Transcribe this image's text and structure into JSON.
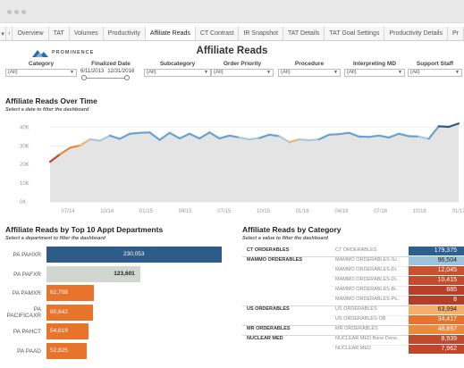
{
  "tabs": {
    "nav_down": "▾",
    "nav_prev": "‹",
    "items": [
      "Overview",
      "TAT",
      "Volumes",
      "Productivity",
      "Affiliate Reads",
      "CT Contrast",
      "IR Snapshot",
      "TAT Details",
      "TAT Goal Settings",
      "Productivity Details",
      "Pr"
    ],
    "active": "Affiliate Reads"
  },
  "header": {
    "logo_text": "PROMINENCE",
    "title": "Affiliate Reads"
  },
  "filters": {
    "category": {
      "label": "Category",
      "value": "(All)"
    },
    "finalized_date": {
      "label": "Finalized Date",
      "start": "6/11/2013",
      "end": "12/31/2016"
    },
    "subcategory": {
      "label": "Subcategory",
      "value": "(All)"
    },
    "order_priority": {
      "label": "Order Priority",
      "value": "(All)"
    },
    "procedure": {
      "label": "Procedure",
      "value": "(All)"
    },
    "interpreting_md": {
      "label": "Interpreting MD",
      "value": "(All)"
    },
    "support_staff": {
      "label": "Support Staff",
      "value": "(All)"
    }
  },
  "line_section": {
    "title": "Affiliate Reads Over Time",
    "subtitle": "Select a date to filter the dashboard"
  },
  "dept_section": {
    "title": "Affiliate Reads by Top 10 Appt Departments",
    "subtitle": "Select a department to filter the dashboard"
  },
  "cat_section": {
    "title": "Affiliate Reads by Category",
    "subtitle": "Select a value to filter the dashboard"
  },
  "colors": {
    "bar_top": "#2e5c8a",
    "bar_second": "#d1d7d0",
    "bar_orange": "#e8742c",
    "line": "#6aa2cf",
    "area": "#e4e4e4"
  },
  "chart_data": [
    {
      "type": "area",
      "title": "Affiliate Reads Over Time",
      "xlabel": "",
      "ylabel": "",
      "x": [
        "2013-07",
        "2013-08",
        "2013-09",
        "2013-10",
        "2013-11",
        "2013-12",
        "2014-01",
        "2014-02",
        "2014-03",
        "2014-04",
        "2014-05",
        "2014-06",
        "2014-07",
        "2014-08",
        "2014-09",
        "2014-10",
        "2014-11",
        "2014-12",
        "2015-01",
        "2015-02",
        "2015-03",
        "2015-04",
        "2015-05",
        "2015-06",
        "2015-07",
        "2015-08",
        "2015-09",
        "2015-10",
        "2015-11",
        "2015-12",
        "2016-01",
        "2016-02",
        "2016-03",
        "2016-04",
        "2016-05",
        "2016-06",
        "2016-07",
        "2016-08",
        "2016-09",
        "2016-10",
        "2016-11",
        "2016-12"
      ],
      "values": [
        21500,
        25500,
        29000,
        30200,
        33500,
        32800,
        35500,
        33800,
        36500,
        37000,
        37200,
        33200,
        37000,
        34000,
        36500,
        34000,
        37200,
        34000,
        35500,
        34500,
        33500,
        34200,
        36000,
        35200,
        32000,
        33500,
        33000,
        33500,
        36000,
        36300,
        37000,
        35000,
        34800,
        35500,
        34500,
        36500,
        35200,
        35000,
        33800,
        40500,
        40200,
        42000
      ],
      "xticks": [
        "07/14",
        "10/14",
        "01/15",
        "04/15",
        "07/15",
        "10/15",
        "01/16",
        "04/16",
        "07/16",
        "10/16",
        "01/17"
      ],
      "yticks": [
        "40K",
        "30K",
        "20K",
        "10K",
        "0K"
      ],
      "ylim": [
        0,
        45000
      ],
      "grid": true
    },
    {
      "type": "bar",
      "title": "Affiliate Reads by Top 10 Appt Departments",
      "categories": [
        "PA PAHXR",
        "PA PAFXR",
        "PA PAMXR",
        "PA PACIFICAXR",
        "PA PAHCT",
        "PA PAAD"
      ],
      "values": [
        230053,
        123601,
        62708,
        60642,
        54619,
        52825
      ],
      "value_labels": [
        "230,053",
        "123,601",
        "62,708",
        "60,642",
        "54,619",
        "52,825"
      ]
    },
    {
      "type": "table",
      "title": "Affiliate Reads by Category",
      "rows": [
        {
          "category": "CT ORDERABLES",
          "subcategory": "CT ORDERABLES",
          "value": "179,375",
          "color": "#2d5f8f",
          "text": "#ffffff"
        },
        {
          "category": "MAMMO ORDERABLES",
          "subcategory": "MAMMO ORDERABLES-Sc..",
          "value": "96,504",
          "color": "#9cc4dd",
          "text": "#222222"
        },
        {
          "category": "",
          "subcategory": "MAMMO ORDERABLES-Di..",
          "value": "12,045",
          "color": "#c9512f",
          "text": "#ffffff"
        },
        {
          "category": "",
          "subcategory": "MAMMO ORDERABLES-Di..",
          "value": "10,415",
          "color": "#c44b2b",
          "text": "#ffffff"
        },
        {
          "category": "",
          "subcategory": "MAMMO ORDERABLES-Bi..",
          "value": "685",
          "color": "#b8402a",
          "text": "#ffffff"
        },
        {
          "category": "",
          "subcategory": "MAMMO ORDERABLES-Pk..",
          "value": "8",
          "color": "#b33d28",
          "text": "#ffffff"
        },
        {
          "category": "US ORDERABLES",
          "subcategory": "US ORDERABLES",
          "value": "63,994",
          "color": "#f3b06a",
          "text": "#222222"
        },
        {
          "category": "",
          "subcategory": "US ORDERABLES-OB",
          "value": "34,417",
          "color": "#e8742c",
          "text": "#ffffff"
        },
        {
          "category": "MR ORDERABLES",
          "subcategory": "MR ORDERABLES",
          "value": "48,897",
          "color": "#e98a3e",
          "text": "#ffffff"
        },
        {
          "category": "NUCLEAR MED",
          "subcategory": "NUCLEAR MED Bone Dens..",
          "value": "8,939",
          "color": "#c04a2c",
          "text": "#ffffff"
        },
        {
          "category": "",
          "subcategory": "NUCLEAR MED",
          "value": "7,962",
          "color": "#bd462b",
          "text": "#ffffff"
        }
      ]
    }
  ]
}
